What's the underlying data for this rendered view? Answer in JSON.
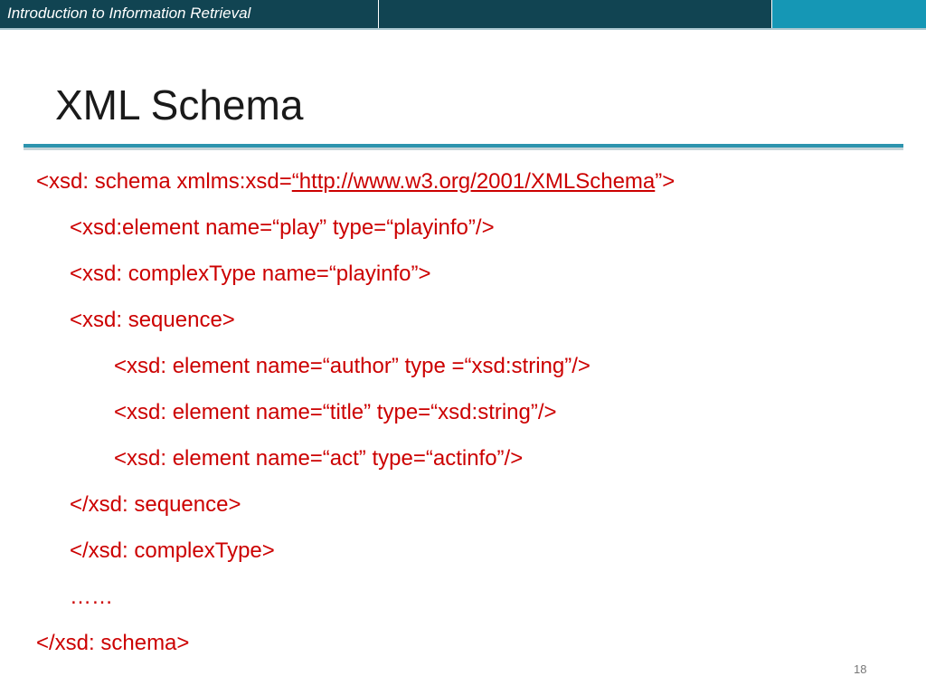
{
  "header": {
    "course_title": "Introduction to Information Retrieval"
  },
  "slide": {
    "title": "XML Schema",
    "page_number": "18"
  },
  "code": {
    "line1_prefix": "<xsd: schema xmlms:xsd=",
    "line1_link": "“http://www.w3.org/2001/XMLSchema",
    "line1_suffix": "”>",
    "line2": "<xsd:element name=“play” type=“playinfo”/>",
    "line3": "<xsd: complexType name=“playinfo”>",
    "line4": "<xsd: sequence>",
    "line5": "<xsd: element name=“author” type =“xsd:string”/>",
    "line6": "<xsd: element name=“title” type=“xsd:string”/>",
    "line7": "<xsd: element name=“act” type=“actinfo”/>",
    "line8": "</xsd: sequence>",
    "line9": "</xsd: complexType>",
    "line10": "……",
    "line11": "</xsd: schema>"
  },
  "colors": {
    "header_dark": "#114452",
    "header_accent": "#1597b5",
    "rule": "#2d94ae",
    "code_text": "#cc0000"
  }
}
